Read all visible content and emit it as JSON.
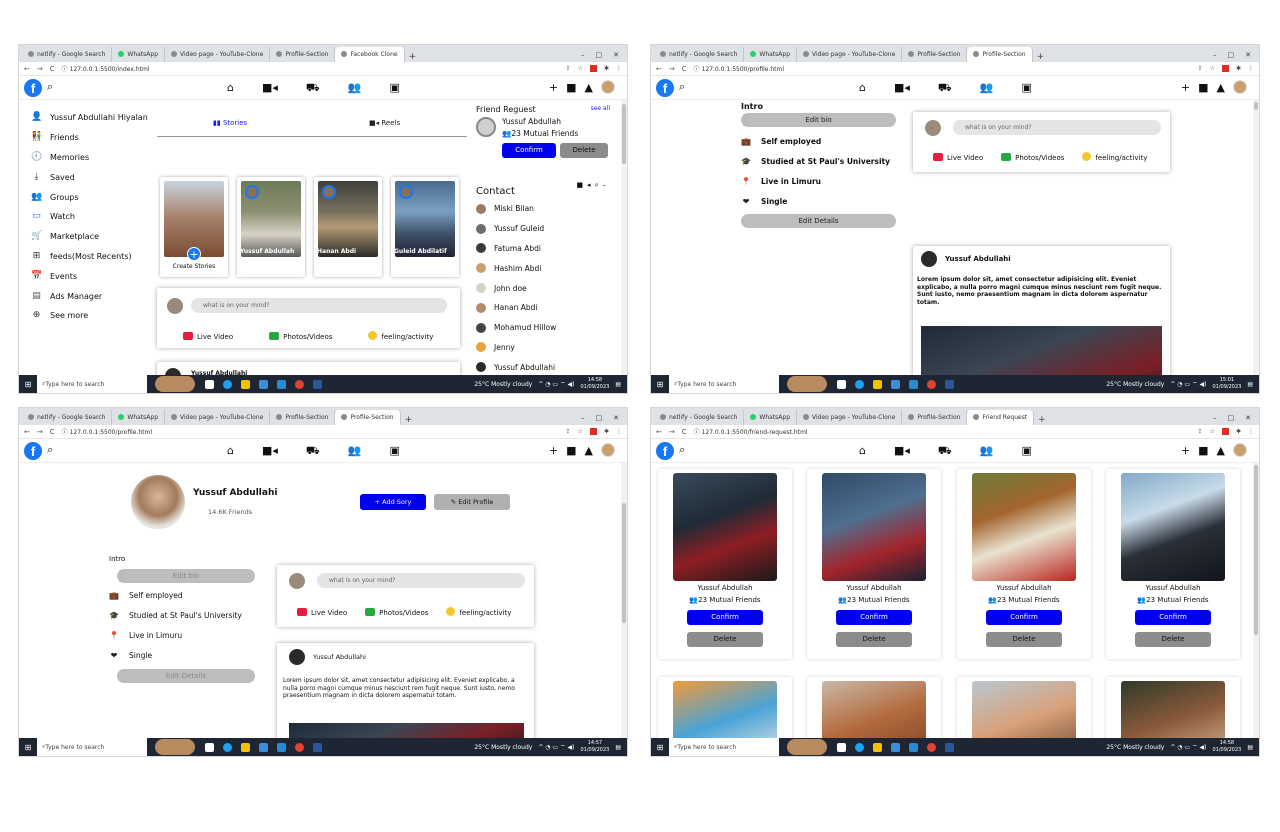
{
  "shared": {
    "taskbar": {
      "search_placeholder": "Type here to search",
      "weather": "25°C  Mostly cloudy",
      "date": "01/09/2023"
    },
    "fb_search_icon": "⌕",
    "nav_icons": [
      "home-icon",
      "video-icon",
      "marketplace-icon",
      "groups-icon",
      "gaming-icon"
    ],
    "nav_right_icons": [
      "plus-icon",
      "messenger-icon",
      "bell-icon",
      "profile-avatar"
    ],
    "colors": {
      "fb_blue": "#1877f2",
      "confirm_blue": "#0000ee",
      "delete_grey": "#8c8c8c"
    }
  },
  "s1": {
    "tabs": [
      "netlify - Google Search",
      "WhatsApp",
      "Video page - YouTube-Clone",
      "Profile-Section",
      "Facebook Clone"
    ],
    "url": "127.0.0.1:5500/index.html",
    "clock": "14:58",
    "sidebar": [
      {
        "label": "Yussuf Abdullahi Hiyalan",
        "icon": "👤"
      },
      {
        "label": "Friends",
        "icon": "👫"
      },
      {
        "label": "Memories",
        "icon": "🕘"
      },
      {
        "label": "Saved",
        "icon": "⤓"
      },
      {
        "label": "Groups",
        "icon": "👥"
      },
      {
        "label": "Watch",
        "icon": "▭"
      },
      {
        "label": "Marketplace",
        "icon": "🛒"
      },
      {
        "label": "feeds(Most Recents)",
        "icon": "⊞"
      },
      {
        "label": "Events",
        "icon": "📅"
      },
      {
        "label": "Ads Manager",
        "icon": "▤"
      },
      {
        "label": "See more",
        "icon": "⊕"
      }
    ],
    "stories_tab": "Stories",
    "reels_tab": "Reels",
    "stories": [
      {
        "name": "",
        "caption": "Create Stories"
      },
      {
        "name": "Yussuf Abdullah",
        "caption": ""
      },
      {
        "name": "Hanan Abdi",
        "caption": ""
      },
      {
        "name": "Guleid Abdilatif",
        "caption": ""
      }
    ],
    "composer_placeholder": "what is on your mind?",
    "composer_actions": [
      "Live Video",
      "Photos/Videos",
      "feeling/activity"
    ],
    "friend_request": {
      "title": "Friend Reguest",
      "see_all": "see all",
      "name": "Yussuf Abdullah",
      "mutual": "23 Mutual Friends",
      "confirm": "Confirm",
      "delete": "Delete"
    },
    "contact_title": "Contact",
    "contacts": [
      "Miski Bilan",
      "Yussuf Guleid",
      "Fatuma Abdi",
      "Hashim Abdi",
      "John doe",
      "Hanan Abdi",
      "Mohamud Hillow",
      "Jenny",
      "Yussuf Abdullahi"
    ],
    "partial_post_name": "Yussuf Abdullahi"
  },
  "s2": {
    "tabs": [
      "netlify - Google Search",
      "WhatsApp",
      "Video page - YouTube-Clone",
      "Profile-Section",
      "Profile-Section"
    ],
    "url": "127.0.0.1:5500/profile.html",
    "clock": "15:01",
    "intro_title": "Intro",
    "edit_bio": "Edit bio",
    "intro": [
      {
        "label": "Self employed",
        "icon": "💼"
      },
      {
        "label": "Studied at St Paul's University",
        "icon": "🎓"
      },
      {
        "label": "Live in Limuru",
        "icon": "📍"
      },
      {
        "label": "Single",
        "icon": "❤"
      }
    ],
    "edit_details": "Edit Details",
    "composer_placeholder": "what is on your mind?",
    "composer_actions": [
      "Live Video",
      "Photos/Videos",
      "feeling/activity"
    ],
    "post_user": "Yussuf Abdullahi",
    "post_text": "Lorem ipsum dolor sit, amet consectetur adipisicing elit. Eveniet explicabo, a nulla porro magni cumque minus nesciunt rem fugit neque. Sunt iusto, nemo praesentium magnam in dicta dolorem aspernatur totam."
  },
  "s3": {
    "tabs": [
      "netlify - Google Search",
      "WhatsApp",
      "Video page - YouTube-Clone",
      "Profile-Section",
      "Profile-Section"
    ],
    "url": "127.0.0.1:5500/profile.html",
    "clock": "14:57",
    "profile_name": "Yussuf Abdullahi",
    "friends_count": "14.6K Friends",
    "add_story": "+ Add Sory",
    "edit_profile": "Edit Profile",
    "intro_title": "Intro",
    "edit_bio": "Edit bio",
    "intro": [
      {
        "label": "Self employed",
        "icon": "💼"
      },
      {
        "label": "Studied at St Paul's University",
        "icon": "🎓"
      },
      {
        "label": "Live in Limuru",
        "icon": "📍"
      },
      {
        "label": "Single",
        "icon": "❤"
      }
    ],
    "edit_details": "Edit Details",
    "composer_placeholder": "what is on your mind?",
    "composer_actions": [
      "Live Video",
      "Photos/Videos",
      "feeling/activity"
    ],
    "post_user": "Yussuf Abdullahi",
    "post_text": "Lorem ipsum dolor sit, amet consectetur adipisicing elit. Eveniet explicabo, a nulla porro magni cumque minus nesciunt rem fugit neque. Sunt iusto, nemo praesentium magnam in dicta dolorem aspernatur totam."
  },
  "s4": {
    "tabs": [
      "netlify - Google Search",
      "WhatsApp",
      "Video page - YouTube-Clone",
      "Profile-Section",
      "Friend Request"
    ],
    "url": "127.0.0.1:5500/friend-request.html",
    "clock": "14:58",
    "cards": [
      {
        "name": "Yussuf Abdullah",
        "mutual": "23 Mutual Friends",
        "confirm": "Confirm",
        "delete": "Delete"
      },
      {
        "name": "Yussuf Abdullah",
        "mutual": "23 Mutual Friends",
        "confirm": "Confirm",
        "delete": "Delete"
      },
      {
        "name": "Yussuf Abdullah",
        "mutual": "23 Mutual Friends",
        "confirm": "Confirm",
        "delete": "Delete"
      },
      {
        "name": "Yussuf Abdullah",
        "mutual": "23 Mutual Friends",
        "confirm": "Confirm",
        "delete": "Delete"
      }
    ]
  }
}
